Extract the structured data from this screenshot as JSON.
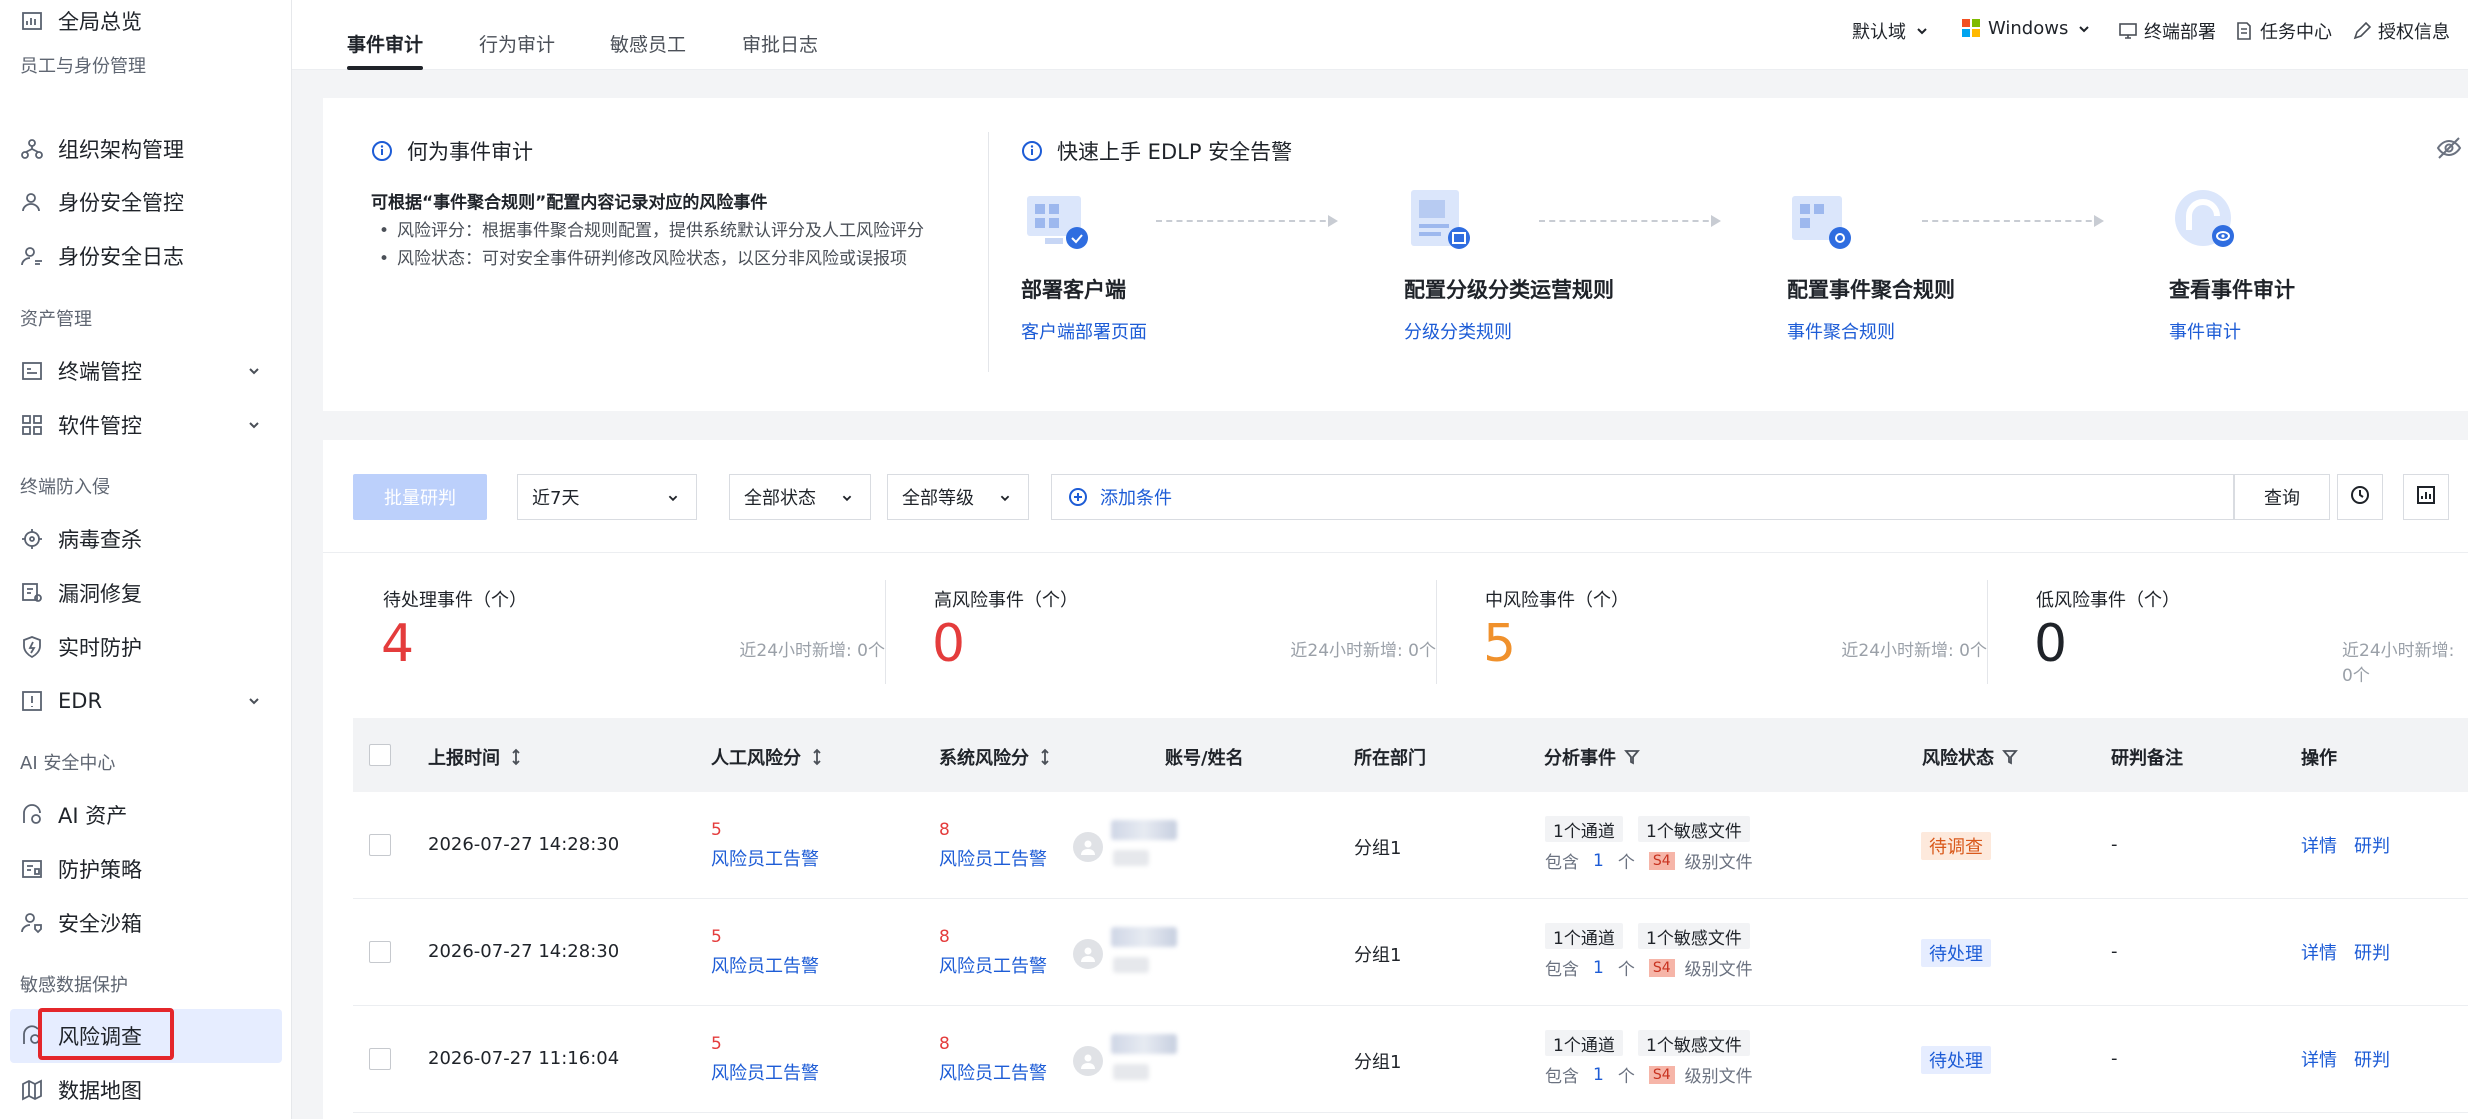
{
  "sidebar": {
    "overview": "全局总览",
    "groups": {
      "identity": "员工与身份管理",
      "assets": "资产管理",
      "intrusion": "终端防入侵",
      "ai": "AI 安全中心",
      "data": "敏感数据保护"
    },
    "items": {
      "org": "组织架构管理",
      "id_control": "身份安全管控",
      "id_log": "身份安全日志",
      "terminal": "终端管控",
      "software": "软件管控",
      "virus": "病毒查杀",
      "vuln": "漏洞修复",
      "realtime": "实时防护",
      "edr": "EDR",
      "ai_assets": "AI 资产",
      "policy": "防护策略",
      "sandbox": "安全沙箱",
      "risk": "风险调查",
      "datamap": "数据地图"
    }
  },
  "tabs": [
    "事件审计",
    "行为审计",
    "敏感员工",
    "审批日志"
  ],
  "topbar": {
    "domain": "默认域",
    "os": "Windows",
    "deploy": "终端部署",
    "tasks": "任务中心",
    "license": "授权信息"
  },
  "intro": {
    "what_title": "何为事件审计",
    "what_bold": "可根据“事件聚合规则”配置内容记录对应的风险事件",
    "bullet1": "风险评分：根据事件聚合规则配置，提供系统默认评分及人工风险评分",
    "bullet2": "风险状态：可对安全事件研判修改风险状态，以区分非风险或误报项",
    "quick_title": "快速上手 EDLP 安全告警",
    "steps": [
      {
        "title": "部署客户端",
        "link": "客户端部署页面"
      },
      {
        "title": "配置分级分类运营规则",
        "link": "分级分类规则"
      },
      {
        "title": "配置事件聚合规则",
        "link": "事件聚合规则"
      },
      {
        "title": "查看事件审计",
        "link": "事件审计"
      }
    ]
  },
  "toolbar": {
    "batch": "批量研判",
    "time": "近7天",
    "status": "全部状态",
    "level": "全部等级",
    "add_condition": "添加条件",
    "query": "查询"
  },
  "stats": [
    {
      "label": "待处理事件（个）",
      "value": "4",
      "sub": "近24小时新增: 0个",
      "color": "#e43c3c"
    },
    {
      "label": "高风险事件（个）",
      "value": "0",
      "sub": "近24小时新增: 0个",
      "color": "#e43c3c"
    },
    {
      "label": "中风险事件（个）",
      "value": "5",
      "sub": "近24小时新增: 0个",
      "color": "#f0912c"
    },
    {
      "label": "低风险事件（个）",
      "value": "0",
      "sub": "近24小时新增: 0个",
      "color": "#1f2329"
    }
  ],
  "table": {
    "headers": {
      "time": "上报时间",
      "manual": "人工风险分",
      "system": "系统风险分",
      "account": "账号/姓名",
      "dept": "所在部门",
      "analysis": "分析事件",
      "status": "风险状态",
      "note": "研判备注",
      "ops": "操作"
    },
    "rows": [
      {
        "time": "2026-07-27 14:28:30",
        "manual_score": "5",
        "manual_label": "风险员工告警",
        "system_score": "8",
        "system_label": "风险员工告警",
        "dept": "分组1",
        "chip1": "1个通道",
        "chip2": "1个敏感文件",
        "contain": "包含",
        "count": "1",
        "unit": "个",
        "level": "S4",
        "level_text": "级别文件",
        "status": "待调查",
        "note": "-",
        "detail": "详情",
        "judge": "研判"
      },
      {
        "time": "2026-07-27 14:28:30",
        "manual_score": "5",
        "manual_label": "风险员工告警",
        "system_score": "8",
        "system_label": "风险员工告警",
        "dept": "分组1",
        "chip1": "1个通道",
        "chip2": "1个敏感文件",
        "contain": "包含",
        "count": "1",
        "unit": "个",
        "level": "S4",
        "level_text": "级别文件",
        "status": "待处理",
        "note": "-",
        "detail": "详情",
        "judge": "研判"
      },
      {
        "time": "2026-07-27 11:16:04",
        "manual_score": "5",
        "manual_label": "风险员工告警",
        "system_score": "8",
        "system_label": "风险员工告警",
        "dept": "分组1",
        "chip1": "1个通道",
        "chip2": "1个敏感文件",
        "contain": "包含",
        "count": "1",
        "unit": "个",
        "level": "S4",
        "level_text": "级别文件",
        "status": "待处理",
        "note": "-",
        "detail": "详情",
        "judge": "研判"
      }
    ]
  },
  "colors": {
    "accent": "#1d5cd6",
    "danger": "#e43c3c",
    "warning": "#f0912c",
    "highlight": "#e4262b"
  }
}
